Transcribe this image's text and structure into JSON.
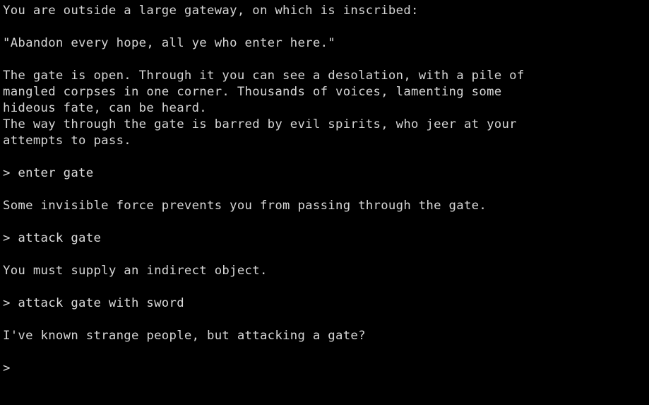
{
  "terminal": {
    "background_color": "#000000",
    "text_color": "#d6d6d6",
    "prompt_symbol": ">",
    "cursor_visible": false,
    "lines": [
      {
        "kind": "narration",
        "text": "You are outside a large gateway, on which is inscribed:"
      },
      {
        "kind": "blank",
        "text": ""
      },
      {
        "kind": "narration",
        "text": "\"Abandon every hope, all ye who enter here.\""
      },
      {
        "kind": "blank",
        "text": ""
      },
      {
        "kind": "narration",
        "text": "The gate is open. Through it you can see a desolation, with a pile of"
      },
      {
        "kind": "narration",
        "text": "mangled corpses in one corner. Thousands of voices, lamenting some"
      },
      {
        "kind": "narration",
        "text": "hideous fate, can be heard."
      },
      {
        "kind": "narration",
        "text": "The way through the gate is barred by evil spirits, who jeer at your"
      },
      {
        "kind": "narration",
        "text": "attempts to pass."
      },
      {
        "kind": "blank",
        "text": ""
      },
      {
        "kind": "command",
        "text": "> enter gate"
      },
      {
        "kind": "blank",
        "text": ""
      },
      {
        "kind": "response",
        "text": "Some invisible force prevents you from passing through the gate."
      },
      {
        "kind": "blank",
        "text": ""
      },
      {
        "kind": "command",
        "text": "> attack gate"
      },
      {
        "kind": "blank",
        "text": ""
      },
      {
        "kind": "response",
        "text": "You must supply an indirect object."
      },
      {
        "kind": "blank",
        "text": ""
      },
      {
        "kind": "command",
        "text": "> attack gate with sword"
      },
      {
        "kind": "blank",
        "text": ""
      },
      {
        "kind": "response",
        "text": "I've known strange people, but attacking a gate?"
      },
      {
        "kind": "blank",
        "text": ""
      },
      {
        "kind": "prompt-only",
        "text": ">"
      }
    ]
  }
}
